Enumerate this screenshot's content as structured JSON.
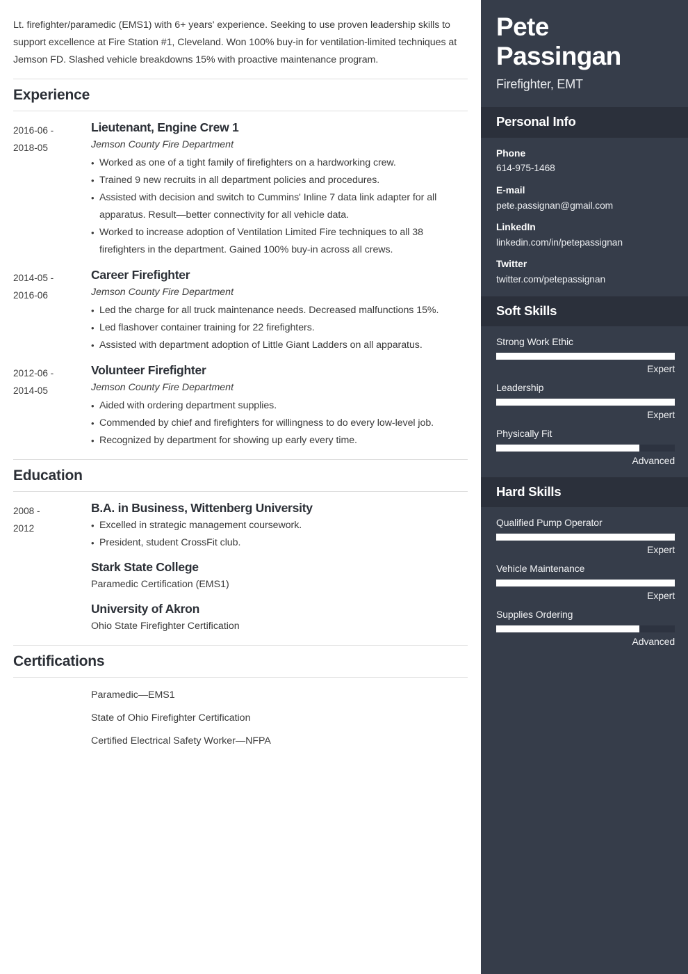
{
  "colors": {
    "sidebar_bg": "#363d4a",
    "sidebar_band_bg": "#2b303b",
    "bar_fill": "#ffffff",
    "bar_track": "#2d3340",
    "body_text": "#3a3a3a",
    "heading_text": "#2b2f36"
  },
  "main": {
    "summary": "Lt. firefighter/paramedic (EMS1) with 6+ years' experience. Seeking to use proven leadership skills to support excellence at Fire Station #1, Cleveland. Won 100% buy-in for ventilation-limited techniques at Jemson FD. Slashed vehicle breakdowns 15% with proactive maintenance program.",
    "sections": {
      "experience": {
        "heading": "Experience",
        "entries": [
          {
            "date_start": "2016-06 -",
            "date_end": "2018-05",
            "title": "Lieutenant, Engine Crew 1",
            "org": "Jemson County Fire Department",
            "bullets": [
              "Worked as one of a tight family of firefighters on a hardworking crew.",
              "Trained 9 new recruits in all department policies and procedures.",
              "Assisted with decision and switch to Cummins' Inline 7 data link adapter for all apparatus. Result—better connectivity for all vehicle data.",
              "Worked to increase adoption of Ventilation Limited Fire techniques to all 38 firefighters in the department. Gained 100% buy-in across all crews."
            ]
          },
          {
            "date_start": "2014-05 -",
            "date_end": "2016-06",
            "title": "Career Firefighter",
            "org": "Jemson County Fire Department",
            "bullets": [
              "Led the charge for all truck maintenance needs. Decreased malfunctions 15%.",
              "Led flashover container training for 22 firefighters.",
              "Assisted with department adoption of Little Giant Ladders on all apparatus."
            ]
          },
          {
            "date_start": "2012-06 -",
            "date_end": "2014-05",
            "title": "Volunteer Firefighter",
            "org": "Jemson County Fire Department",
            "bullets": [
              "Aided with ordering department supplies.",
              "Commended by chief and firefighters for willingness to do every low-level job.",
              "Recognized by department for showing up early every time."
            ]
          }
        ]
      },
      "education": {
        "heading": "Education",
        "entries": [
          {
            "date_start": "2008 -",
            "date_end": "2012",
            "title": "B.A. in Business, Wittenberg University",
            "bullets": [
              "Excelled in strategic management coursework.",
              "President, student CrossFit club."
            ]
          },
          {
            "date_start": "",
            "date_end": "",
            "title": "Stark State College",
            "detail": "Paramedic Certification (EMS1)"
          },
          {
            "date_start": "",
            "date_end": "",
            "title": "University of Akron",
            "detail": "Ohio State Firefighter Certification"
          }
        ]
      },
      "certifications": {
        "heading": "Certifications",
        "items": [
          "Paramedic—EMS1",
          "State of Ohio Firefighter Certification",
          "Certified Electrical Safety Worker—NFPA"
        ]
      }
    }
  },
  "sidebar": {
    "name": "Pete Passingan",
    "role": "Firefighter, EMT",
    "personal_info": {
      "heading": "Personal Info",
      "items": [
        {
          "label": "Phone",
          "value": "614-975-1468"
        },
        {
          "label": "E-mail",
          "value": "pete.passignan@gmail.com"
        },
        {
          "label": "LinkedIn",
          "value": "linkedin.com/in/petepassignan"
        },
        {
          "label": "Twitter",
          "value": "twitter.com/petepassignan"
        }
      ]
    },
    "soft_skills": {
      "heading": "Soft Skills",
      "items": [
        {
          "name": "Strong Work Ethic",
          "level": "Expert",
          "percent": 100
        },
        {
          "name": "Leadership",
          "level": "Expert",
          "percent": 100
        },
        {
          "name": "Physically Fit",
          "level": "Advanced",
          "percent": 80
        }
      ]
    },
    "hard_skills": {
      "heading": "Hard Skills",
      "items": [
        {
          "name": "Qualified Pump Operator",
          "level": "Expert",
          "percent": 100
        },
        {
          "name": "Vehicle Maintenance",
          "level": "Expert",
          "percent": 100
        },
        {
          "name": "Supplies Ordering",
          "level": "Advanced",
          "percent": 80
        }
      ]
    }
  }
}
